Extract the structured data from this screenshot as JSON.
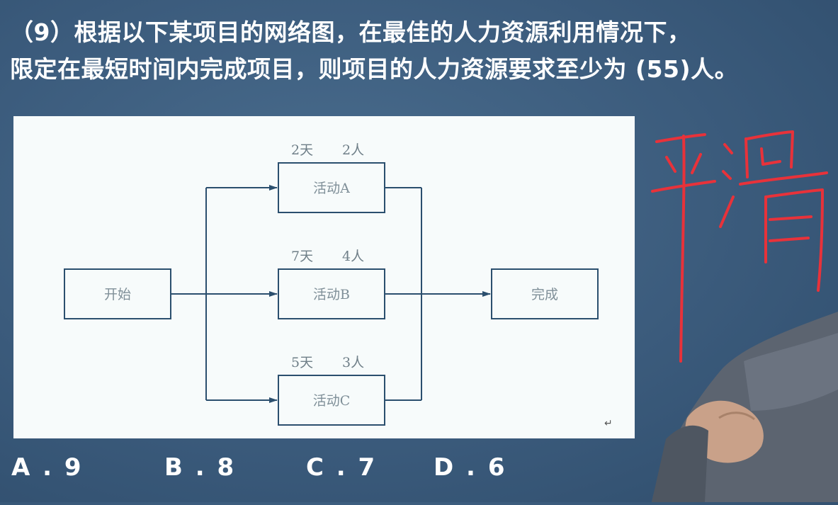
{
  "question": {
    "line1": "（9）根据以下某项目的网络图，在最佳的人力资源利用情况下，",
    "line2": "限定在最短时间内完成项目，则项目的人力资源要求至少为 (55)人。"
  },
  "diagram": {
    "start": "开始",
    "end": "完成",
    "activities": [
      {
        "label": "活动A",
        "days": "2天",
        "people": "2人"
      },
      {
        "label": "活动B",
        "days": "7天",
        "people": "4人"
      },
      {
        "label": "活动C",
        "days": "5天",
        "people": "3人"
      }
    ],
    "return_mark": "↵"
  },
  "options": [
    {
      "letter": "A",
      "value": "9",
      "text": "A . 9"
    },
    {
      "letter": "B",
      "value": "8",
      "text": "B . 8"
    },
    {
      "letter": "C",
      "value": "7",
      "text": "C . 7"
    },
    {
      "letter": "D",
      "value": "6",
      "text": "D . 6"
    }
  ],
  "colors": {
    "background": "#3b5b7c",
    "question_text": "#ffffff",
    "diagram_lines": "#2b4f6e",
    "handwriting": "#e8323a"
  },
  "handwriting_note": "平滑"
}
